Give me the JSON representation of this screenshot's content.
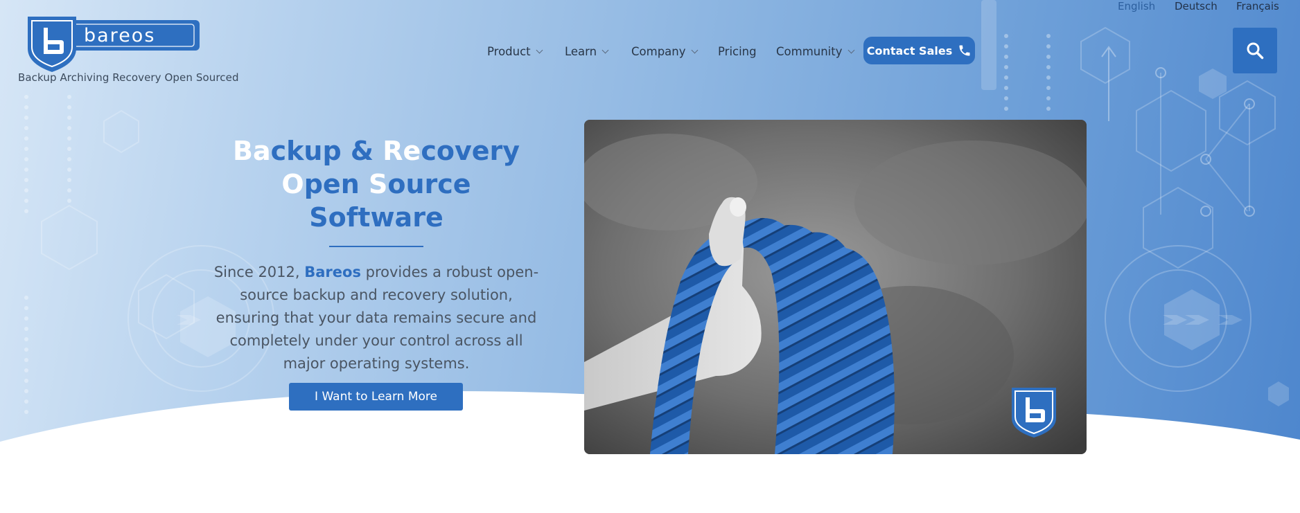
{
  "logo": {
    "wordmark": "bareos",
    "tagline": "Backup Archiving Recovery Open Sourced"
  },
  "languages": [
    {
      "label": "English",
      "active": true
    },
    {
      "label": "Deutsch",
      "active": false
    },
    {
      "label": "Français",
      "active": false
    }
  ],
  "nav": {
    "items": [
      {
        "label": "Product",
        "has_dropdown": true
      },
      {
        "label": "Learn",
        "has_dropdown": true
      },
      {
        "label": "Company",
        "has_dropdown": true
      },
      {
        "label": "Pricing",
        "has_dropdown": false
      },
      {
        "label": "Community",
        "has_dropdown": true
      }
    ],
    "contact_label": "Contact Sales",
    "contact_icon": "phone-icon",
    "search_icon": "search-icon"
  },
  "hero": {
    "headline_line1": "Backup & Recovery",
    "headline_line2": "Open Source",
    "headline_line3": "Software",
    "desc_before": "Since 2012, ",
    "desc_brand": "Bareos",
    "desc_after": " provides a robust open-source backup and recovery solution, ensuring that your data remains secure and completely under your control across all major operating systems.",
    "cta_label": "I Want to Learn More",
    "image_subject": "hand-holding-blue-rope"
  },
  "colors": {
    "brand_blue": "#2e6fc0",
    "text_dark": "#283648",
    "text_body": "#4a5563",
    "bg_light": "#d6e6f6",
    "bg_dark": "#4d86cd"
  }
}
